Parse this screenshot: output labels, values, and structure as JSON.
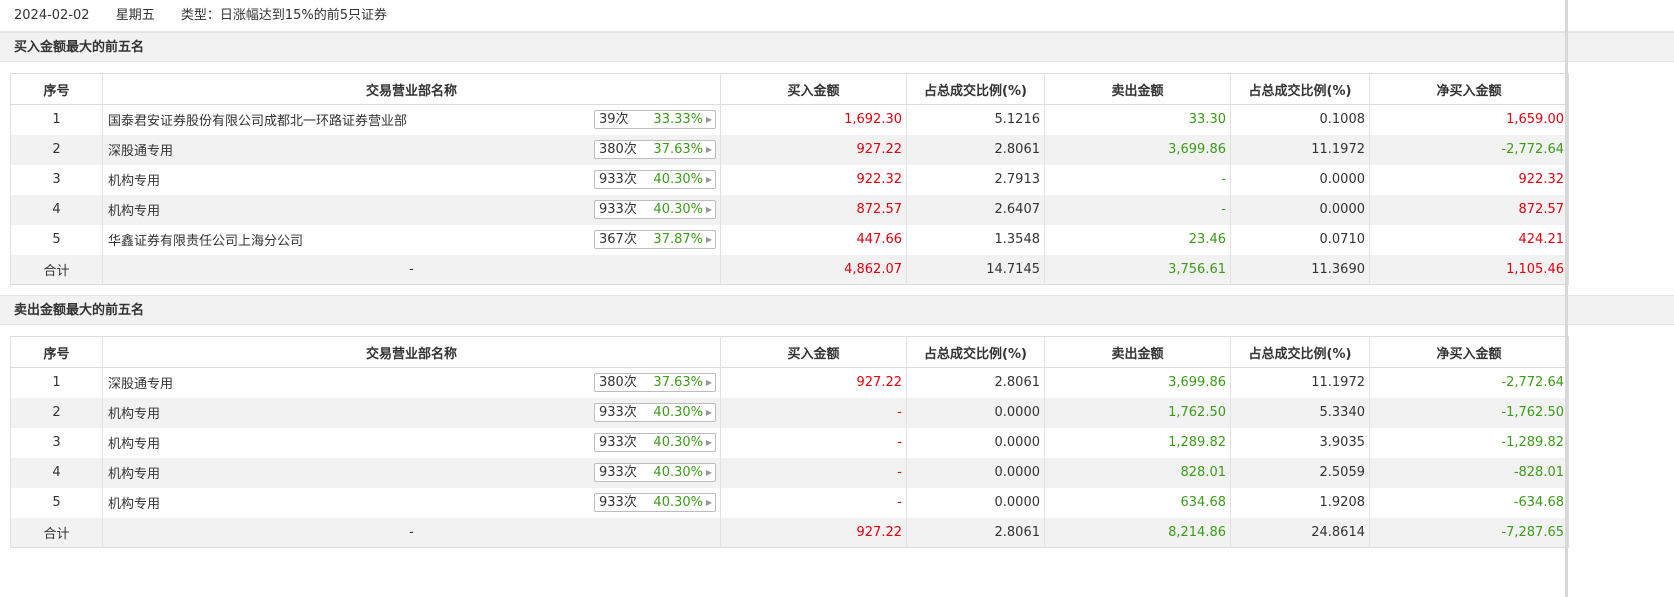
{
  "header": {
    "date": "2024-02-02",
    "weekday": "星期五",
    "type": "类型：日涨幅达到15%的前5只证券"
  },
  "columns": [
    "序号",
    "交易营业部名称",
    "买入金额",
    "占总成交比例(%)",
    "卖出金额",
    "占总成交比例(%)",
    "净买入金额"
  ],
  "buy_section": {
    "title": "买入金额最大的前五名",
    "rows": [
      {
        "no": "1",
        "name": "国泰君安证券股份有限公司成都北一环路证券营业部",
        "times": "39次",
        "rate": "33.33%",
        "buy": "1,692.30",
        "buy_pct": "5.1216",
        "sell": "33.30",
        "sell_pct": "0.1008",
        "net": "1,659.00"
      },
      {
        "no": "2",
        "name": "深股通专用",
        "times": "380次",
        "rate": "37.63%",
        "buy": "927.22",
        "buy_pct": "2.8061",
        "sell": "3,699.86",
        "sell_pct": "11.1972",
        "net": "-2,772.64"
      },
      {
        "no": "3",
        "name": "机构专用",
        "times": "933次",
        "rate": "40.30%",
        "buy": "922.32",
        "buy_pct": "2.7913",
        "sell": "-",
        "sell_pct": "0.0000",
        "net": "922.32"
      },
      {
        "no": "4",
        "name": "机构专用",
        "times": "933次",
        "rate": "40.30%",
        "buy": "872.57",
        "buy_pct": "2.6407",
        "sell": "-",
        "sell_pct": "0.0000",
        "net": "872.57"
      },
      {
        "no": "5",
        "name": "华鑫证券有限责任公司上海分公司",
        "times": "367次",
        "rate": "37.87%",
        "buy": "447.66",
        "buy_pct": "1.3548",
        "sell": "23.46",
        "sell_pct": "0.0710",
        "net": "424.21"
      }
    ],
    "total": {
      "label": "合计",
      "name": "-",
      "buy": "4,862.07",
      "buy_pct": "14.7145",
      "sell": "3,756.61",
      "sell_pct": "11.3690",
      "net": "1,105.46"
    }
  },
  "sell_section": {
    "title": "卖出金额最大的前五名",
    "rows": [
      {
        "no": "1",
        "name": "深股通专用",
        "times": "380次",
        "rate": "37.63%",
        "buy": "927.22",
        "buy_pct": "2.8061",
        "sell": "3,699.86",
        "sell_pct": "11.1972",
        "net": "-2,772.64"
      },
      {
        "no": "2",
        "name": "机构专用",
        "times": "933次",
        "rate": "40.30%",
        "buy": "-",
        "buy_pct": "0.0000",
        "sell": "1,762.50",
        "sell_pct": "5.3340",
        "net": "-1,762.50"
      },
      {
        "no": "3",
        "name": "机构专用",
        "times": "933次",
        "rate": "40.30%",
        "buy": "-",
        "buy_pct": "0.0000",
        "sell": "1,289.82",
        "sell_pct": "3.9035",
        "net": "-1,289.82"
      },
      {
        "no": "4",
        "name": "机构专用",
        "times": "933次",
        "rate": "40.30%",
        "buy": "-",
        "buy_pct": "0.0000",
        "sell": "828.01",
        "sell_pct": "2.5059",
        "net": "-828.01"
      },
      {
        "no": "5",
        "name": "机构专用",
        "times": "933次",
        "rate": "40.30%",
        "buy": "-",
        "buy_pct": "0.0000",
        "sell": "634.68",
        "sell_pct": "1.9208",
        "net": "-634.68"
      }
    ],
    "total": {
      "label": "合计",
      "name": "-",
      "buy": "927.22",
      "buy_pct": "2.8061",
      "sell": "8,214.86",
      "sell_pct": "24.8614",
      "net": "-7,287.65"
    }
  },
  "colors": {
    "up": "#e4000f",
    "down": "#3c9c18",
    "stripe": "#f2f2f2"
  }
}
